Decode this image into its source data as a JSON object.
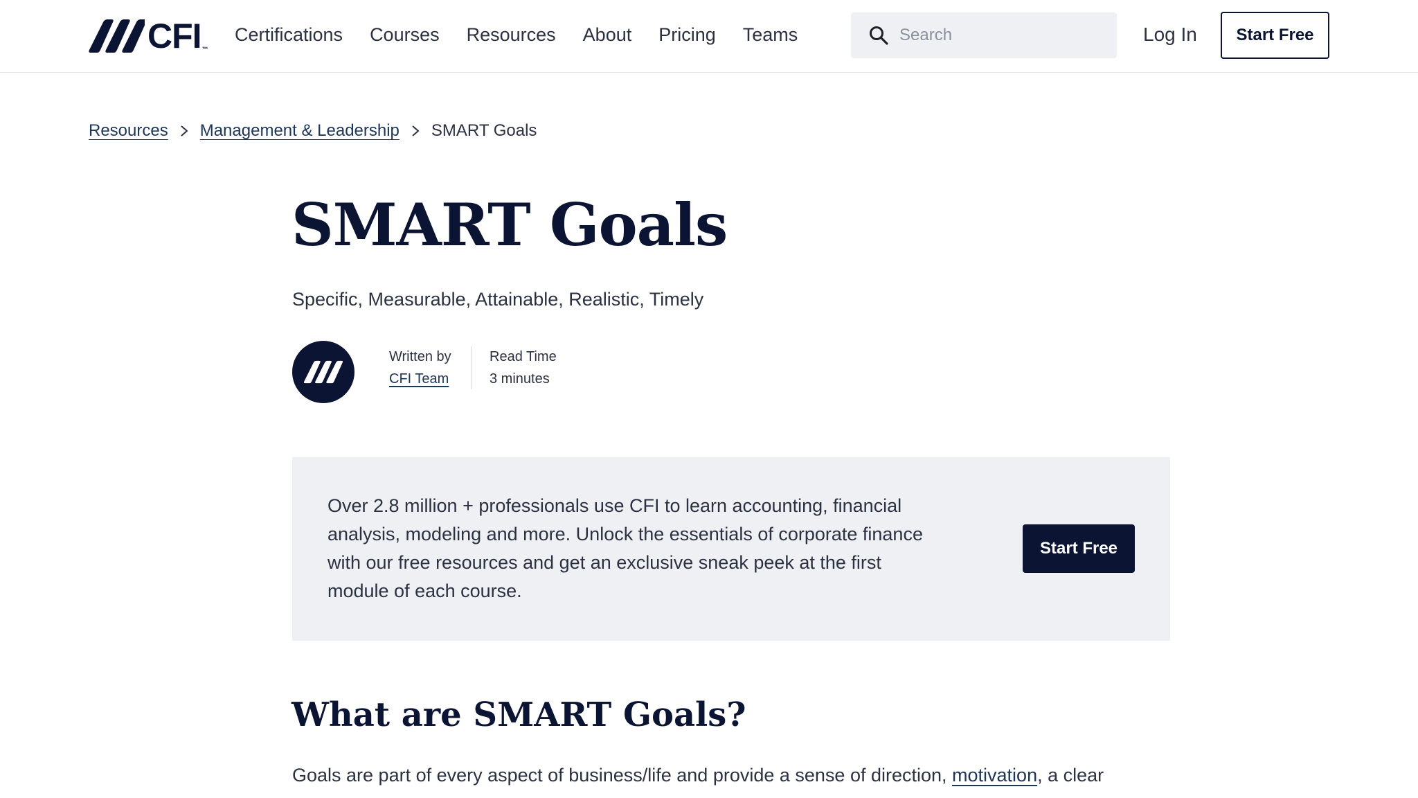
{
  "header": {
    "logo_text": "CFI",
    "logo_tm": "™",
    "nav": [
      "Certifications",
      "Courses",
      "Resources",
      "About",
      "Pricing",
      "Teams"
    ],
    "search_placeholder": "Search",
    "login_label": "Log In",
    "start_free_label": "Start Free"
  },
  "breadcrumb": {
    "items": [
      "Resources",
      "Management & Leadership"
    ],
    "current": "SMART Goals"
  },
  "article": {
    "title": "SMART Goals",
    "subtitle": "Specific, Measurable, Attainable, Realistic, Timely",
    "written_by_label": "Written by",
    "author": "CFI Team",
    "read_time_label": "Read Time",
    "read_time": "3 minutes"
  },
  "promo": {
    "text": "Over 2.8 million + professionals use CFI to learn accounting, financial analysis, modeling and more. Unlock the essentials of corporate finance with our free resources and get an exclusive sneak peek at the first module of each course.",
    "button_label": "Start Free"
  },
  "section": {
    "heading": "What are SMART Goals?",
    "body_before": "Goals are part of every aspect of business/life and provide a sense of direction, ",
    "body_link": "motivation",
    "body_after": ", a clear"
  },
  "colors": {
    "brand_navy": "#0b1533",
    "link": "#1d3557",
    "promo_bg": "#eef0f4",
    "search_bg": "#eef0f4"
  },
  "icons": {
    "logo": "cfi-stripes-icon",
    "search": "search-icon",
    "breadcrumb_sep": "chevron-right-icon",
    "avatar": "cfi-stripes-icon"
  }
}
